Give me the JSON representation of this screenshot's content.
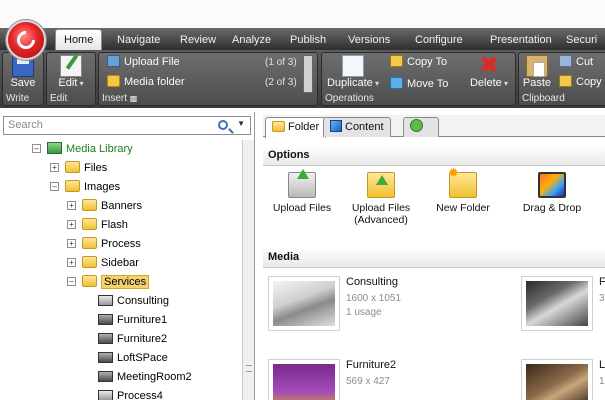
{
  "menu": {
    "tabs": [
      "Home",
      "Navigate",
      "Review",
      "Analyze",
      "Publish",
      "Versions",
      "Configure",
      "Presentation",
      "Securi"
    ]
  },
  "ribbon": {
    "write": {
      "label": "Write",
      "save": "Save"
    },
    "edit": {
      "label": "Edit",
      "edit": "Edit"
    },
    "insert": {
      "label": "Insert",
      "items": [
        {
          "label": "Upload File",
          "count": "(1 of 3)"
        },
        {
          "label": "Media folder",
          "count": "(2 of 3)"
        }
      ]
    },
    "operations": {
      "label": "Operations",
      "duplicate": "Duplicate",
      "copy_to": "Copy To",
      "move_to": "Move To",
      "delete": "Delete"
    },
    "clipboard": {
      "label": "Clipboard",
      "paste": "Paste",
      "cut": "Cut",
      "copy": "Copy"
    }
  },
  "search": {
    "placeholder": "Search"
  },
  "tree": {
    "root": "Media Library",
    "nodes": [
      "Files",
      "Images",
      "Banners",
      "Flash",
      "Process",
      "Sidebar",
      "Services",
      "Consulting",
      "Furniture1",
      "Furniture2",
      "LoftSPace",
      "MeetingRoom2",
      "Process4"
    ]
  },
  "content_tabs": {
    "folder": "Folder",
    "content": "Content"
  },
  "options": {
    "header": "Options",
    "items": [
      "Upload Files",
      "Upload Files (Advanced)",
      "New Folder",
      "Drag & Drop"
    ]
  },
  "media": {
    "header": "Media",
    "items": [
      {
        "title": "Consulting",
        "size": "1600 x 1051",
        "usage": "1 usage"
      },
      {
        "title": "F",
        "size": "3",
        "usage": ""
      },
      {
        "title": "Furniture2",
        "size": "569 x 427",
        "usage": ""
      },
      {
        "title": "L",
        "size": "1",
        "usage": ""
      }
    ]
  }
}
